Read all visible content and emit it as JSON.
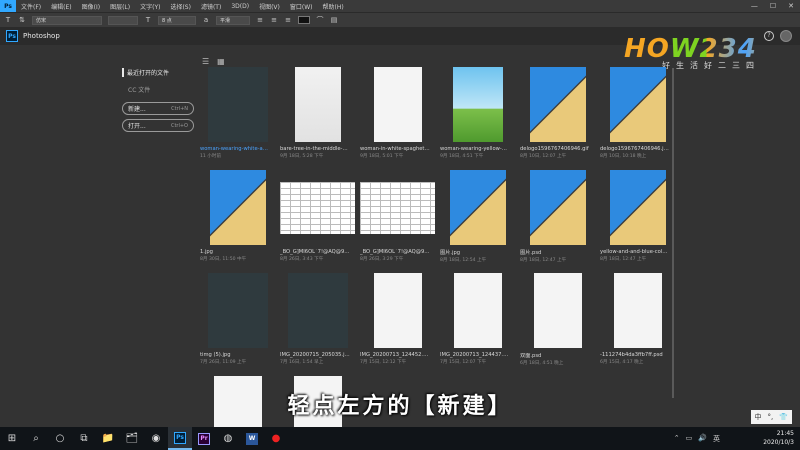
{
  "menubar": {
    "app_badge": "Ps",
    "items": [
      "文件(F)",
      "编辑(E)",
      "图像(I)",
      "图层(L)",
      "文字(Y)",
      "选择(S)",
      "滤镜(T)",
      "3D(D)",
      "视图(V)",
      "窗口(W)",
      "帮助(H)"
    ],
    "window_controls": [
      "—",
      "☐",
      "✕"
    ]
  },
  "optbar": {
    "tool_glyph": "T",
    "font_family": "仿宋",
    "font_size": "8 点",
    "antialias": "平滑"
  },
  "titlebar": {
    "app_name": "Photoshop",
    "help": "?"
  },
  "watermark": {
    "logo": "HOW234",
    "tagline": "好生活好二三四"
  },
  "leftpanel": {
    "recent_title": "最近打开的文件",
    "cc_files": "CC 文件",
    "new_label": "新建...",
    "new_shortcut": "Ctrl+N",
    "open_label": "打开...",
    "open_shortcut": "Ctrl+O"
  },
  "view_toggles": {
    "list": "☰",
    "grid": "▦"
  },
  "files": [
    {
      "name": "woman-wearing-white-and-...",
      "date": "11 小时前",
      "style": "dark",
      "active": true
    },
    {
      "name": "bare-tree-in-the-middle-field-...",
      "date": "9月 18日, 5:28 下午",
      "style": "snow"
    },
    {
      "name": "woman-in-white-spaghetti-st...",
      "date": "9月 18日, 5:01 下午",
      "style": "white"
    },
    {
      "name": "woman-wearing-yellow-dres...",
      "date": "9月 18日, 4:51 下午",
      "style": "sky"
    },
    {
      "name": "delogo1596767406946.gif",
      "date": "8月 10日, 12:07 上午",
      "style": "diag"
    },
    {
      "name": "delogo1596767406946.jpg",
      "date": "8月 10日, 10:18 晚上",
      "style": "diag"
    },
    {
      "name": "1.jpg",
      "date": "8月 30日, 11:50 中午",
      "style": "diag"
    },
    {
      "name": "_BO_G]MI6OL`7!@AQ@9X$S...",
      "date": "8月 26日, 3:43 下午",
      "style": "sheet"
    },
    {
      "name": "_BO_G]MI6OL`7!@AQ@9X$S...",
      "date": "8月 26日, 3:29 下午",
      "style": "sheet"
    },
    {
      "name": "图片.jpg",
      "date": "8月 18日, 12:54 上午",
      "style": "diag"
    },
    {
      "name": "图片.psd",
      "date": "8月 18日, 12:47 上午",
      "style": "diag"
    },
    {
      "name": "yellow-and-and-blue-colore...",
      "date": "8月 18日, 12:47 上午",
      "style": "diag"
    },
    {
      "name": "timg (5).jpg",
      "date": "7月 26日, 11:09 上午",
      "style": "dark"
    },
    {
      "name": "IMG_20200715_205035.jpg",
      "date": "7月 16日, 1:54 早上",
      "style": "dark"
    },
    {
      "name": "IMG_20200713_124452.png",
      "date": "7月 15日, 12:12 下午",
      "style": "white"
    },
    {
      "name": "IMG_20200713_124437.png",
      "date": "7月 15日, 12:07 下午",
      "style": "white"
    },
    {
      "name": "双面.psd",
      "date": "6月 18日, 4:51 晚上",
      "style": "white"
    },
    {
      "name": "-111274b4da3ffb7ff.psd",
      "date": "6月 15日, 4:17 晚上",
      "style": "white"
    },
    {
      "name": "",
      "date": "",
      "style": "white"
    },
    {
      "name": "",
      "date": "",
      "style": "white"
    }
  ],
  "subtitle": "轻点左方的【新建】",
  "ime": {
    "mode": "中",
    "punct": "°,",
    "skin": "👕"
  },
  "taskbar": {
    "start": "⊞",
    "search": "⌕",
    "cortana": "○",
    "taskview": "⧉",
    "apps": [
      "📁",
      "🗂",
      "◉",
      "Ps",
      "Pr",
      "◍",
      "W",
      "●"
    ],
    "clock": "21:45",
    "date": "2020/10/3",
    "tray": [
      "⌃",
      "▭",
      "🔊",
      "英"
    ]
  }
}
